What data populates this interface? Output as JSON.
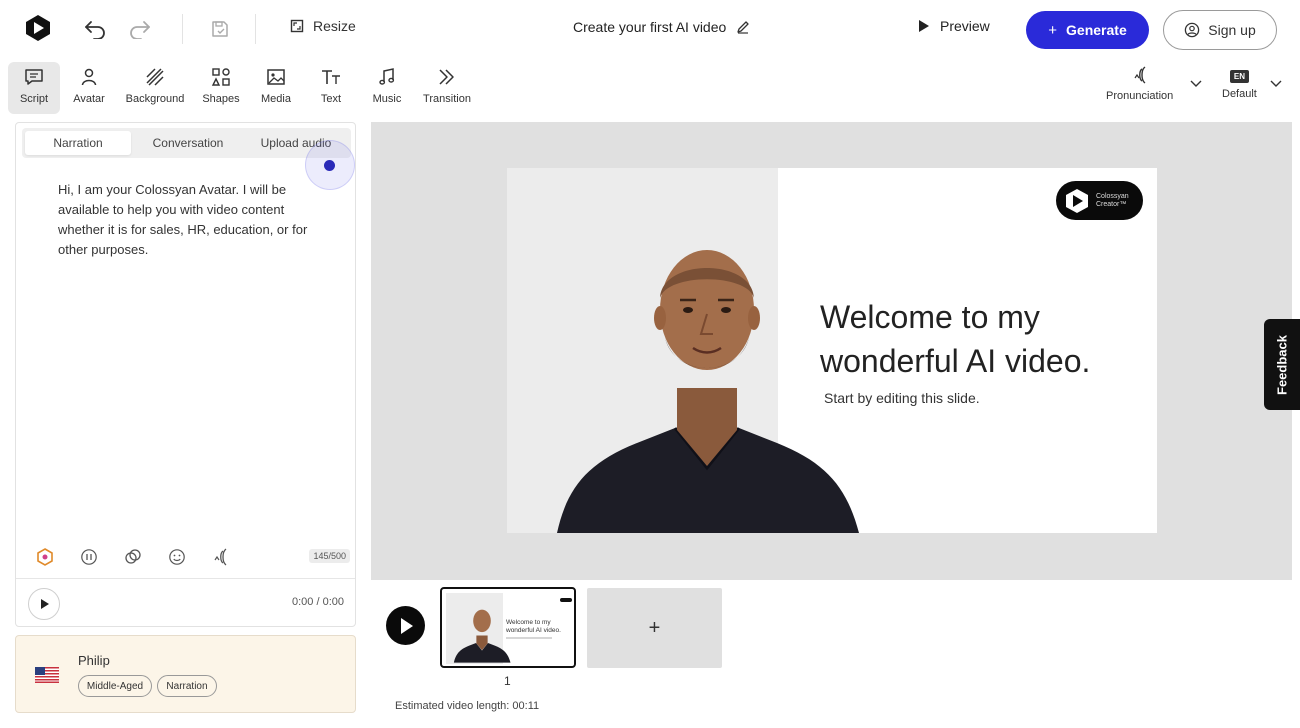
{
  "topbar": {
    "resize_label": "Resize",
    "project_title": "Create your first AI video",
    "preview_label": "Preview",
    "generate_label": "Generate",
    "signup_label": "Sign up"
  },
  "tools": [
    {
      "label": "Script"
    },
    {
      "label": "Avatar"
    },
    {
      "label": "Background"
    },
    {
      "label": "Shapes"
    },
    {
      "label": "Media"
    },
    {
      "label": "Text"
    },
    {
      "label": "Music"
    },
    {
      "label": "Transition"
    }
  ],
  "right_tools": {
    "pronunciation_label": "Pronunciation",
    "language_code": "EN",
    "language_label": "Default"
  },
  "script": {
    "tabs": [
      "Narration",
      "Conversation",
      "Upload audio"
    ],
    "active_tab": "Narration",
    "text": "Hi, I am your Colossyan Avatar. I will be available to help you with video content whether it is for sales, HR, education, or for other purposes.",
    "char_count": "145/500",
    "time": "0:00 / 0:00"
  },
  "avatar": {
    "name": "Philip",
    "tags": [
      "Middle-Aged",
      "Narration"
    ]
  },
  "slide": {
    "heading": "Welcome to my wonderful AI video.",
    "subheading": "Start by editing this slide.",
    "brand_line1": "Colossyan",
    "brand_line2": "Creator™"
  },
  "timeline": {
    "slide_number": "1",
    "add_label": "+",
    "estimated_length": "Estimated video length: 00:11"
  },
  "feedback_label": "Feedback",
  "colors": {
    "accent": "#2a2ad9",
    "avatar_card_bg": "#fcf5e8",
    "canvas_bg": "#e0e0e0"
  }
}
